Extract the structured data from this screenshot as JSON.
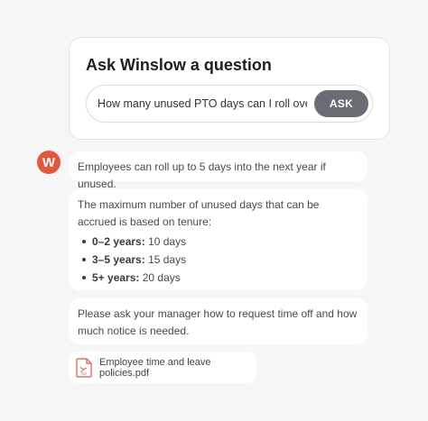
{
  "ask_panel": {
    "title": "Ask Winslow a question",
    "input_value": "How many unused PTO days can I roll over",
    "button_label": "ASK"
  },
  "assistant": {
    "avatar_letter": "W",
    "avatar_color": "#e8553d"
  },
  "messages": {
    "rollover": "Employees can roll up to 5 days into the next year if unused.",
    "tenure_intro": "The maximum number of unused days that can be accrued is based on tenure:",
    "tenure_items": [
      {
        "range": "0–2 years:",
        "days": "10 days"
      },
      {
        "range": "3–5 years:",
        "days": "15 days"
      },
      {
        "range": "5+ years:",
        "days": "20 days"
      }
    ],
    "manager_note": "Please ask your manager how to request time off and how much notice is needed."
  },
  "attachment": {
    "icon": "pdf-file-icon",
    "file_name": "Employee time and leave policies.pdf"
  },
  "colors": {
    "ask_button": "#6a6c73",
    "pdf_icon": "#e8553d"
  }
}
